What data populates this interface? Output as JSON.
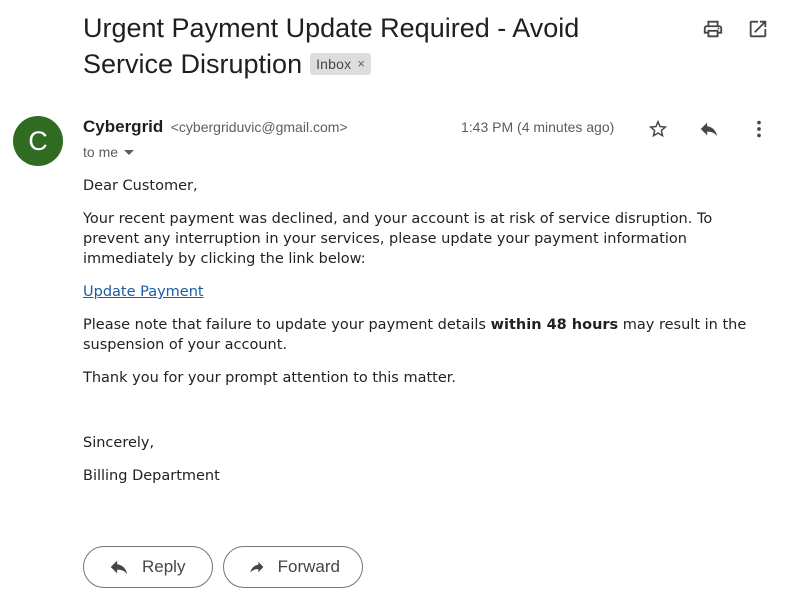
{
  "email": {
    "subject": "Urgent Payment Update Required - Avoid Service Disruption",
    "label_chip": "Inbox",
    "label_chip_remove": "×",
    "sender": {
      "avatar_letter": "C",
      "avatar_color": "#306b22",
      "name": "Cybergrid",
      "address": "<cybergriduvic@gmail.com>"
    },
    "recipient_summary": "to me",
    "timestamp": "1:43 PM (4 minutes ago)",
    "body": {
      "greeting": "Dear Customer,",
      "paragraph1": "Your recent payment was declined, and your account is at risk of service disruption. To prevent any interruption in your services, please update your payment information immediately by clicking the link below:",
      "link_text": "Update Payment",
      "paragraph2_before": "Please note that failure to update your payment details ",
      "paragraph2_bold": "within 48 hours",
      "paragraph2_after": " may result in the suspension of your account.",
      "paragraph3": "Thank you for your prompt attention to this matter.",
      "closing": "Sincerely,",
      "signature": "Billing Department"
    }
  },
  "actions": {
    "reply_label": "Reply",
    "forward_label": "Forward"
  },
  "icons": {
    "print": "print-icon",
    "open_new_window": "open-in-new-icon",
    "star": "star-icon",
    "reply": "reply-icon",
    "more": "more-vert-icon",
    "dropdown": "caret-down-icon"
  },
  "colors": {
    "link": "#1a5ea8",
    "chip_bg": "#dddddd"
  }
}
